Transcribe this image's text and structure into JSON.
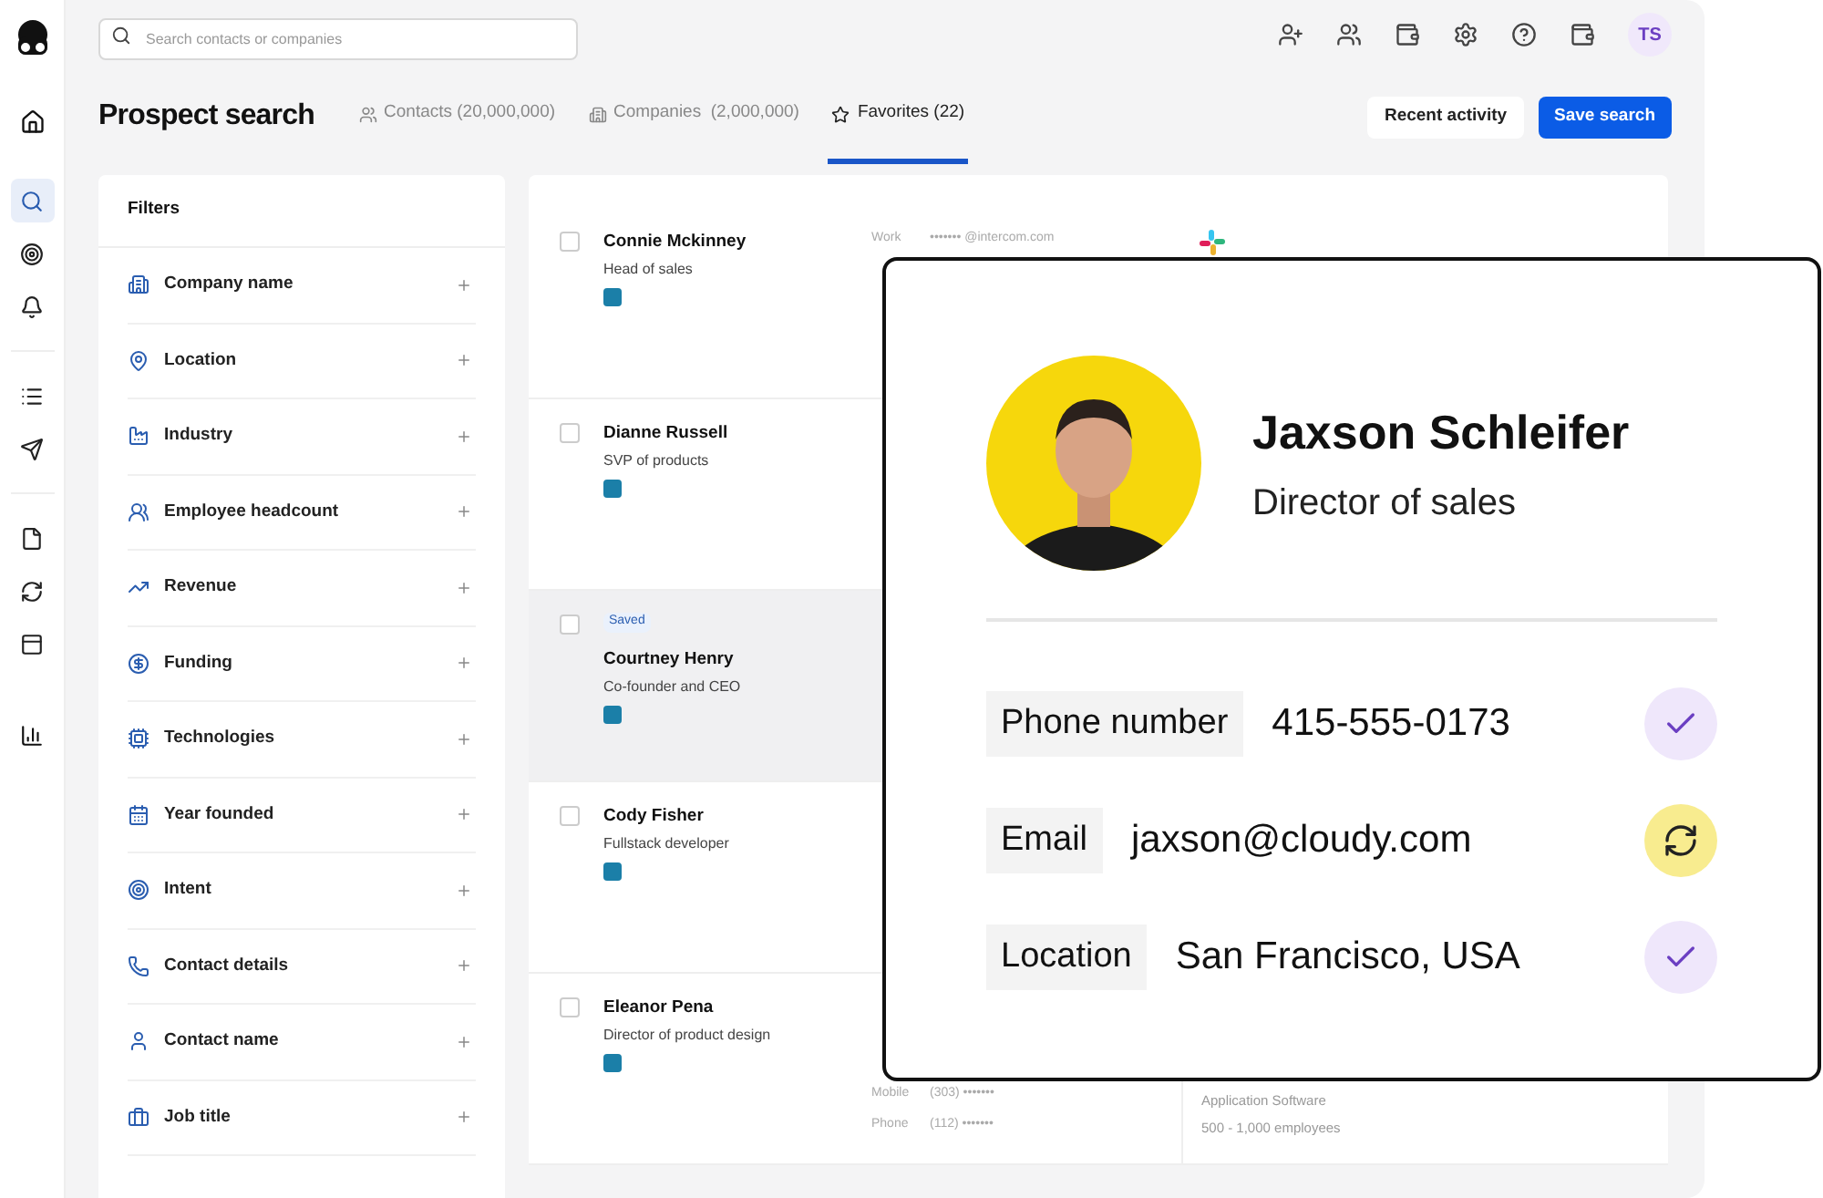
{
  "search": {
    "placeholder": "Search contacts or companies"
  },
  "header": {
    "avatar": "TS"
  },
  "title": "Prospect search",
  "tabs": [
    {
      "label": "Contacts (20,000,000)",
      "selected": false
    },
    {
      "label": "Companies  (2,000,000)",
      "selected": false
    },
    {
      "label": "Favorites (22)",
      "selected": true
    }
  ],
  "actions": [
    "Recent activity",
    "Save search"
  ],
  "filters": {
    "title": "Filters",
    "items": [
      "Company name",
      "Location",
      "Industry",
      "Employee headcount",
      "Revenue",
      "Funding",
      "Technologies",
      "Year founded",
      "Intent",
      "Contact details",
      "Contact name",
      "Job title"
    ]
  },
  "contacts": [
    {
      "name": "Connie Mckinney",
      "role": "Head of sales",
      "checked": false,
      "selected": false,
      "contact_lines": [
        {
          "label": "Work",
          "value": "••••••• @intercom.com"
        }
      ]
    },
    {
      "name": "Dianne Russell",
      "role": "SVP of products",
      "checked": false,
      "selected": false
    },
    {
      "name": "Courtney Henry",
      "role": "Co-founder and CEO",
      "tag": "Saved",
      "checked": false,
      "selected": true
    },
    {
      "name": "Cody Fisher",
      "role": "Fullstack developer",
      "checked": false,
      "selected": false
    },
    {
      "name": "Eleanor Pena",
      "role": "Director of product design",
      "checked": false,
      "selected": false,
      "contact_lines": [
        {
          "label": "Mobile",
          "value": "(303) •••••••"
        },
        {
          "label": "Phone",
          "value": "(112) •••••••"
        }
      ],
      "company_lines": [
        "Application Software",
        "500 - 1,000 employees"
      ]
    }
  ],
  "profile_card": {
    "name": "Jaxson Schleifer",
    "title": "Director of sales",
    "fields": [
      {
        "label": "Phone number",
        "value": "415-555-0173",
        "kind": "verified"
      },
      {
        "label": "Email",
        "value": "jaxson@cloudy.com",
        "kind": "updating"
      },
      {
        "label": "Location",
        "value": "San Francisco, USA",
        "kind": "verified"
      }
    ]
  }
}
